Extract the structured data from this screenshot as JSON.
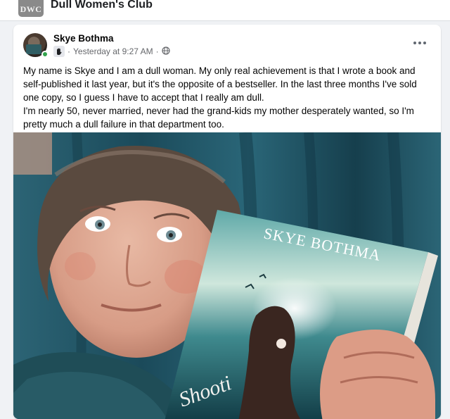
{
  "group": {
    "logo_text": "DWC",
    "name": "Dull Women's Club"
  },
  "post": {
    "author": "Skye Bothma",
    "timestamp": "Yesterday at 9:27 AM",
    "separator": "·",
    "audience_icon": "globe-icon",
    "badge_icon": "hand-wave-icon",
    "menu_icon": "more-options-icon",
    "paragraphs": [
      "My name is Skye and I am a dull woman. My only real achievement is that I wrote a book and self-published it last year, but it's the opposite of a bestseller. In the last three months I've sold one copy, so I guess I have to accept that I really am dull.",
      "I'm nearly 50, never married, never had the grand-kids my mother desperately wanted, so I'm pretty much a dull failure in that department too."
    ]
  },
  "photo": {
    "book_author_text": "Skye Bothma",
    "book_title_partial": "Shooti"
  },
  "colors": {
    "online": "#31a24c",
    "meta_text": "#65676b",
    "curtain": "#1e4f60"
  }
}
